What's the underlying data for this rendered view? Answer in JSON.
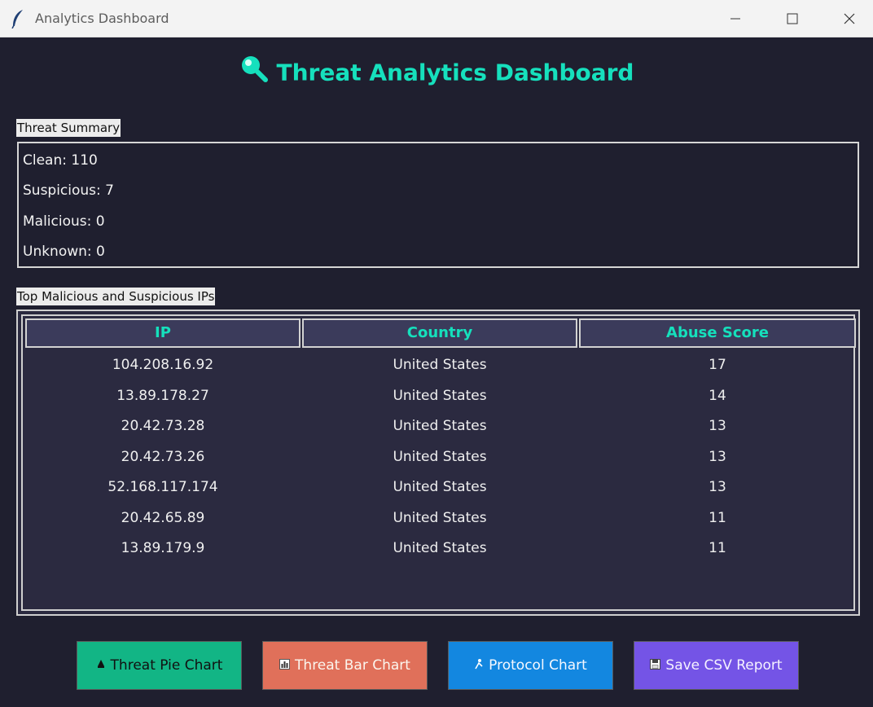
{
  "window": {
    "title": "Analytics Dashboard"
  },
  "header": {
    "title": "Threat Analytics Dashboard",
    "icon": "magnifier-icon"
  },
  "summary": {
    "label": "Threat Summary",
    "lines": [
      "Clean: 110",
      "Suspicious: 7",
      "Malicious: 0",
      "Unknown: 0"
    ]
  },
  "ip_table": {
    "label": "Top Malicious and Suspicious IPs",
    "columns": [
      "IP",
      "Country",
      "Abuse Score"
    ],
    "rows": [
      [
        "104.208.16.92",
        "United States",
        "17"
      ],
      [
        "13.89.178.27",
        "United States",
        "14"
      ],
      [
        "20.42.73.28",
        "United States",
        "13"
      ],
      [
        "20.42.73.26",
        "United States",
        "13"
      ],
      [
        "52.168.117.174",
        "United States",
        "13"
      ],
      [
        "20.42.65.89",
        "United States",
        "11"
      ],
      [
        "13.89.179.9",
        "United States",
        "11"
      ]
    ]
  },
  "buttons": {
    "pie": {
      "label": "Threat Pie Chart",
      "icon": "pie-icon"
    },
    "bar": {
      "label": "Threat Bar Chart",
      "icon": "bar-chart-icon"
    },
    "protocol": {
      "label": "Protocol Chart",
      "icon": "protocol-icon"
    },
    "csv": {
      "label": "Save CSV Report",
      "icon": "floppy-icon"
    }
  },
  "colors": {
    "background": "#1f1f2f",
    "accent": "#16e0bd",
    "header_bg": "#3b3b5b",
    "pie_button": "#12b585",
    "bar_button": "#e0705a",
    "protocol_button": "#1387e0",
    "csv_button": "#7454e6"
  }
}
